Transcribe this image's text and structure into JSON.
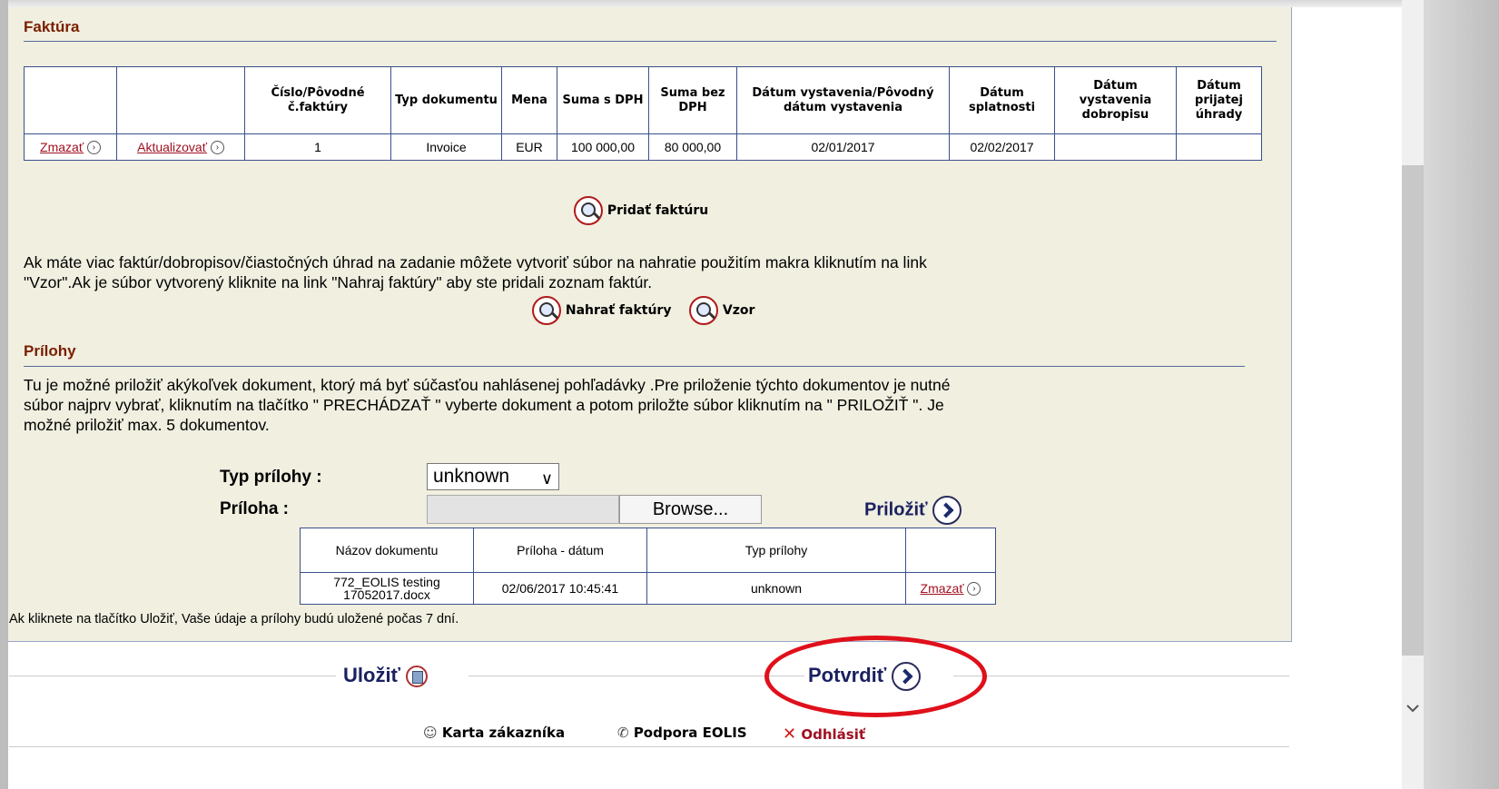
{
  "invoice": {
    "title": "Faktúra",
    "headers": [
      "",
      "",
      "Číslo/Pôvodné č.faktúry",
      "Typ dokumentu",
      "Mena",
      "Suma s DPH",
      "Suma bez DPH",
      "Dátum vystavenia/Pôvodný dátum vystavenia",
      "Dátum splatnosti",
      "Dátum vystavenia dobropisu",
      "Dátum prijatej úhrady"
    ],
    "row": {
      "delete": "Zmazať",
      "update": "Aktualizovať",
      "number": "1",
      "doc_type": "Invoice",
      "currency": "EUR",
      "sum_vat": "100 000,00",
      "sum_no_vat": "80 000,00",
      "issue_date": "02/01/2017",
      "due_date": "02/02/2017",
      "credit_date": "",
      "payment_date": ""
    },
    "add_label": "Pridať faktúru",
    "info_text_1": "Ak máte viac faktúr/dobropisov/čiastočných úhrad na zadanie môžete vytvoriť súbor na nahratie použitím makra kliknutím na link",
    "info_text_2": "\"Vzor\".Ak je súbor vytvorený kliknite na link \"Nahraj faktúry\" aby ste pridali zoznam faktúr.",
    "upload_label": "Nahrať faktúry",
    "template_label": "Vzor"
  },
  "attachments": {
    "title": "Prílohy",
    "text_1": "Tu je možné priložiť akýkoľvek dokument, ktorý má byť súčasťou nahlásenej pohľadávky .Pre priloženie týchto dokumentov je nutné",
    "text_2": "súbor najprv vybrať, kliknutím na tlačítko \" PRECHÁDZAŤ \" vyberte dokument a potom priložte súbor kliknutím na \" PRILOŽIŤ \". Je",
    "text_3": "možné priložiť max. 5 dokumentov.",
    "type_label": "Typ prílohy :",
    "type_value": "unknown",
    "file_label": "Príloha :",
    "browse_label": "Browse...",
    "attach_label": "Priložiť",
    "table_headers": [
      "Názov dokumentu",
      "Príloha - dátum",
      "Typ prílohy",
      ""
    ],
    "file_row": {
      "name_1": "772_EOLIS testing",
      "name_2": "17052017.docx",
      "date": "02/06/2017 10:45:41",
      "type": "unknown",
      "delete": "Zmazať"
    },
    "note": "Ak kliknete na tlačítko Uložiť, Vaše údaje a prílohy budú uložené počas 7 dní."
  },
  "actions": {
    "save": "Uložiť",
    "confirm": "Potvrdiť"
  },
  "footer": {
    "customer_card": "Karta zákazníka",
    "support": "Podpora EOLIS",
    "logout": "Odhlásiť"
  },
  "colors": {
    "highlight": "#e0101b",
    "panel": "#f0efe0",
    "section_title": "#7a1e00"
  }
}
